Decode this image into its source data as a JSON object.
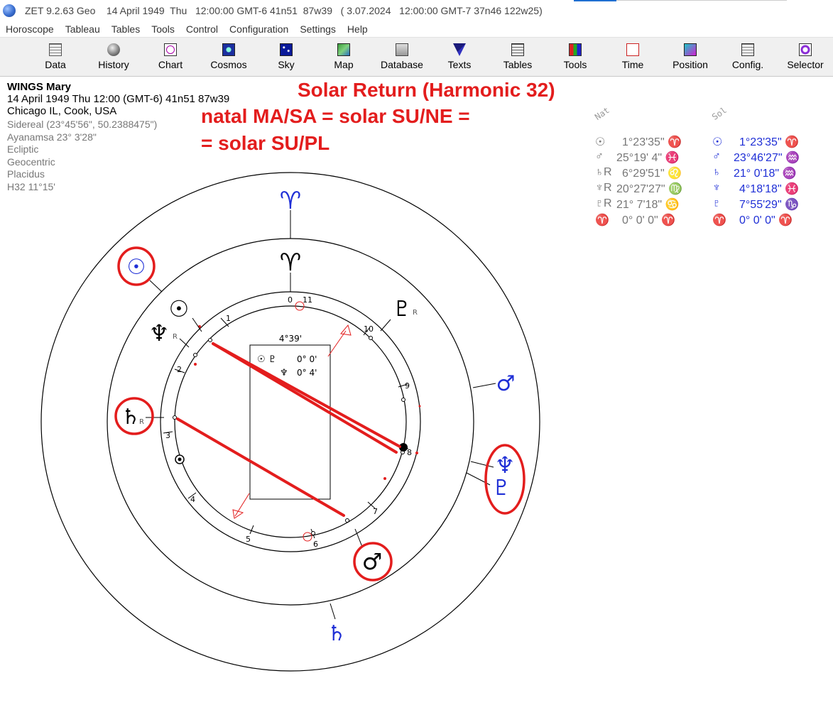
{
  "window": {
    "title": "ZET 9.2.63 Geo    14 April 1949  Thu   12:00:00 GMT-6 41n51  87w39   ( 3.07.2024   12:00:00 GMT-7 37n46 122w25)"
  },
  "menu": [
    "Horoscope",
    "Tableau",
    "Tables",
    "Tools",
    "Control",
    "Configuration",
    "Settings",
    "Help"
  ],
  "toolbar": [
    {
      "label": "Data",
      "icon": "data-grid-icon"
    },
    {
      "label": "History",
      "icon": "history-icon"
    },
    {
      "label": "Chart",
      "icon": "chart-wheel-icon"
    },
    {
      "label": "Cosmos",
      "icon": "cosmos-icon"
    },
    {
      "label": "Sky",
      "icon": "sky-icon"
    },
    {
      "label": "Map",
      "icon": "map-icon"
    },
    {
      "label": "Database",
      "icon": "database-icon"
    },
    {
      "label": "Texts",
      "icon": "texts-icon"
    },
    {
      "label": "Tables",
      "icon": "tables-icon"
    },
    {
      "label": "Tools",
      "icon": "tools-icon"
    },
    {
      "label": "Time",
      "icon": "time-icon"
    },
    {
      "label": "Position",
      "icon": "position-icon"
    },
    {
      "label": "Config.",
      "icon": "config-icon"
    },
    {
      "label": "Selector",
      "icon": "selector-icon"
    }
  ],
  "person": {
    "name": "WINGS Mary",
    "date_line": "14 April 1949  Thu   12:00  (GMT-6)  41n51   87w39",
    "place": "Chicago IL, Cook, USA",
    "sidereal": "Sidereal (23°45'56\", 50.2388475\")",
    "ayanamsa": "Ayanamsa 23° 3'28\"",
    "ecliptic": "Ecliptic",
    "geocentric": "Geocentric",
    "houses": "Placidus",
    "harmonic": "H32  11°15'"
  },
  "annotations": {
    "title": "Solar Return (Harmonic 32)",
    "line1": "natal MA/SA = solar SU/NE =",
    "line2": "= solar SU/PL"
  },
  "positions": {
    "nat_header": "Nat",
    "sol_header": "Sol",
    "nat": [
      {
        "glyph": "☉",
        "value": "1°23'35\" ♈"
      },
      {
        "glyph": "♂",
        "value": "25°19' 4\" ♓"
      },
      {
        "glyph": "♄R",
        "value": "6°29'51\" ♌"
      },
      {
        "glyph": "♆R",
        "value": "20°27'27\" ♍"
      },
      {
        "glyph": "♇R",
        "value": "21° 7'18\" ♋"
      },
      {
        "glyph": "♈",
        "value": "0° 0' 0\" ♈"
      }
    ],
    "sol": [
      {
        "glyph": "☉",
        "value": "1°23'35\" ♈"
      },
      {
        "glyph": "♂",
        "value": "23°46'27\" ♒"
      },
      {
        "glyph": "♄",
        "value": "21° 0'18\" ♒"
      },
      {
        "glyph": "♆",
        "value": "4°18'18\" ♓"
      },
      {
        "glyph": "♇",
        "value": "7°55'29\" ♑"
      },
      {
        "glyph": "♈",
        "value": "0° 0' 0\" ♈"
      }
    ]
  },
  "wheel": {
    "center_value": "4°39'",
    "box_rows": [
      {
        "glyphs": "☉ ♇",
        "value": "0° 0'"
      },
      {
        "glyphs": "♆",
        "value": "0° 4'"
      }
    ],
    "house_numbers": [
      "1",
      "2",
      "3",
      "4",
      "5",
      "6",
      "7",
      "8",
      "9",
      "10",
      "11",
      "0"
    ],
    "aries_glyph": "♈",
    "natal_glyphs": {
      "sun": "☉",
      "neptune": "♆",
      "saturn": "♄",
      "pluto": "♇",
      "mars": "♂",
      "retro": "R"
    },
    "solar_glyphs": {
      "sun": "☉",
      "mars": "♂",
      "neptune": "♆",
      "pluto": "♇",
      "saturn": "♄"
    },
    "colors": {
      "natal": "#000000",
      "solar": "#1f2fd6",
      "highlight": "#e31d1d"
    }
  }
}
